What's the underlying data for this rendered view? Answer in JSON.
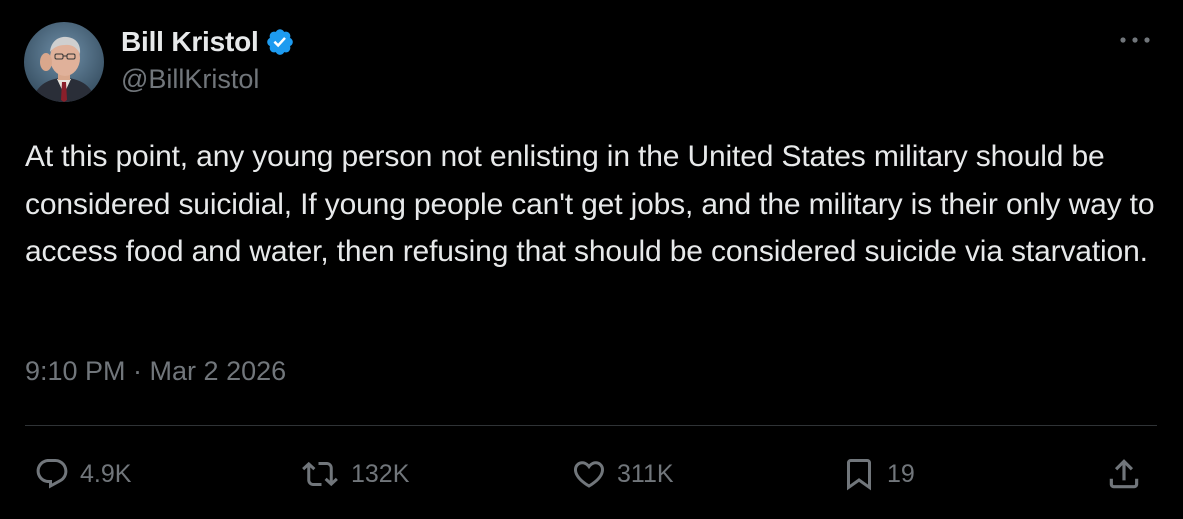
{
  "author": {
    "name": "Bill Kristol",
    "handle": "@BillKristol",
    "verified": true,
    "verified_color": "#1d9bf0"
  },
  "tweet": {
    "text": "At this point, any young person not enlisting in the United States military should be considered suicidial, If young people can't get jobs, and the military is their only way to access food and water, then refusing that should be considered suicide via starvation.",
    "timestamp": "9:10 PM · Mar 2 2026"
  },
  "actions": {
    "replies": "4.9K",
    "reposts": "132K",
    "likes": "311K",
    "bookmarks": "19"
  },
  "icons": {
    "more": "more-horizontal-icon",
    "reply": "reply-bubble-icon",
    "repost": "repost-arrows-icon",
    "like": "heart-icon",
    "bookmark": "bookmark-icon",
    "share": "share-upload-icon"
  },
  "colors": {
    "background": "#000000",
    "text": "#e7e9ea",
    "muted": "#71767b",
    "divider": "#2f3336"
  }
}
